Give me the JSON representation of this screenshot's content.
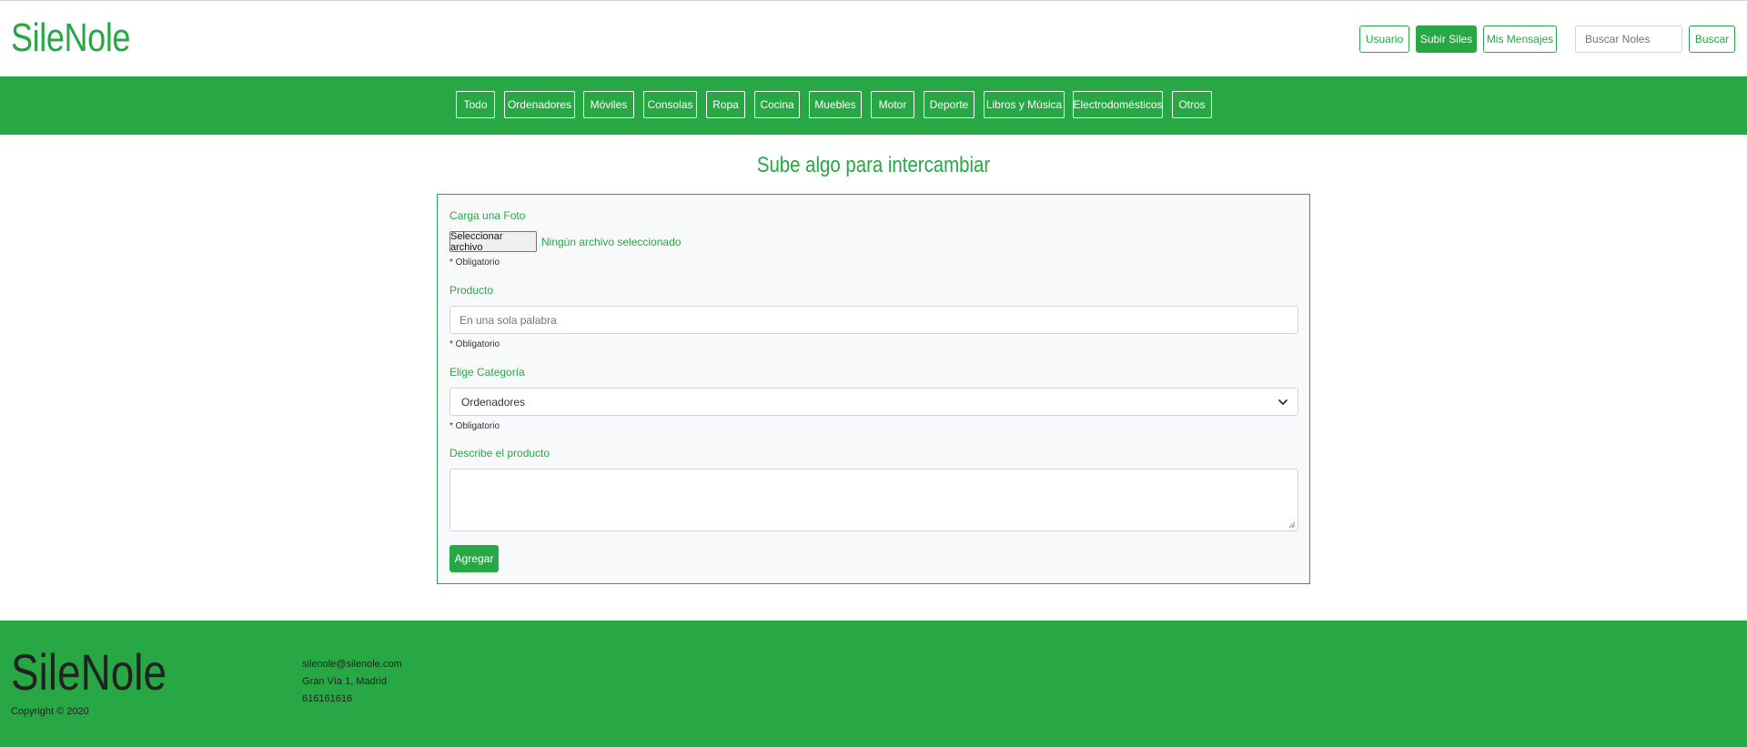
{
  "header": {
    "brand": "SileNole",
    "buttons": {
      "usuario": "Usuario",
      "subir": "Subir Siles",
      "mensajes": "Mis Mensajes",
      "buscar": "Buscar"
    },
    "search_placeholder": "Buscar Noles"
  },
  "categories": [
    "Todo",
    "Ordenadores",
    "Móviles",
    "Consolas",
    "Ropa",
    "Cocina",
    "Muebles",
    "Motor",
    "Deporte",
    "Libros y Música",
    "Electrodomésticos",
    "Otros"
  ],
  "form": {
    "title": "Sube algo para intercambiar",
    "photo_label": "Carga una Foto",
    "file_button": "Seleccionar archivo",
    "file_status": "Ningún archivo seleccionado",
    "required": "* Obligatorio",
    "product_label": "Producto",
    "product_placeholder": "En una sola palabra",
    "category_label": "Elige Categoría",
    "category_selected": "Ordenadores",
    "description_label": "Describe el producto",
    "submit": "Agregar"
  },
  "footer": {
    "brand": "SileNole",
    "copyright": "Copyright © 2020",
    "email": "silenole@silenole.com",
    "address": "Gran Vía 1, Madrid",
    "phone": "616161616"
  },
  "colors": {
    "accent": "#28a745"
  }
}
